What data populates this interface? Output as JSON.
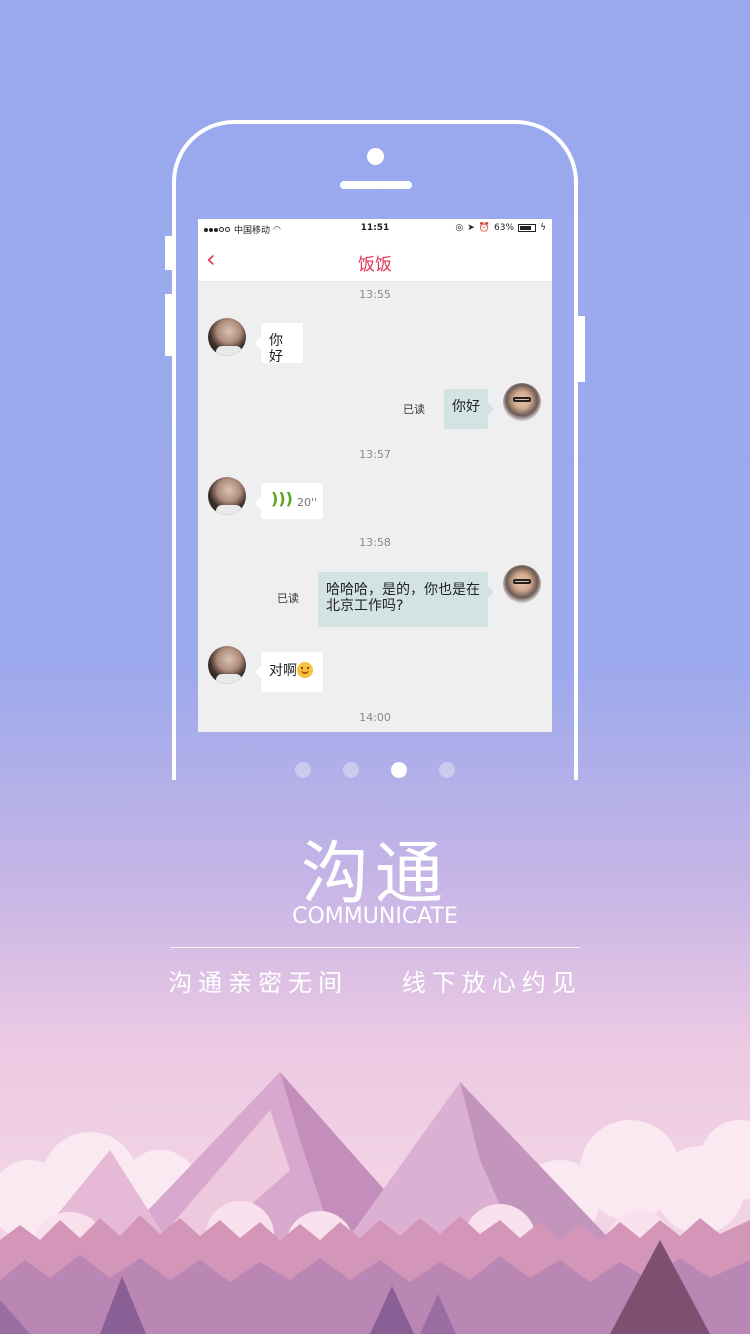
{
  "status_bar": {
    "carrier": "中国移动",
    "time": "11:51",
    "battery": "63%"
  },
  "chat": {
    "title": "饭饭",
    "read_label": "已读",
    "messages": [
      {
        "type": "timestamp",
        "text": "13:55"
      },
      {
        "type": "incoming",
        "text": "你好"
      },
      {
        "type": "outgoing",
        "text": "你好",
        "read": "已读"
      },
      {
        "type": "timestamp",
        "text": "13:57"
      },
      {
        "type": "incoming-voice",
        "duration": "20''"
      },
      {
        "type": "timestamp",
        "text": "13:58"
      },
      {
        "type": "outgoing",
        "text": "哈哈哈，是的，你也是在北京工作吗?",
        "read": "已读"
      },
      {
        "type": "incoming",
        "text": "对啊",
        "emoji": "smile-emoji"
      },
      {
        "type": "timestamp",
        "text": "14:00"
      }
    ]
  },
  "pager": {
    "count": 4,
    "active_index": 2
  },
  "feature": {
    "title_cn": "沟通",
    "title_en": "COMMUNICATE",
    "tagline_left": "沟通亲密无间",
    "tagline_right": "线下放心约见"
  },
  "colors": {
    "accent": "#e0335a",
    "outgoing_bubble": "#d3e3e4",
    "voice_icon": "#5aa51c"
  }
}
